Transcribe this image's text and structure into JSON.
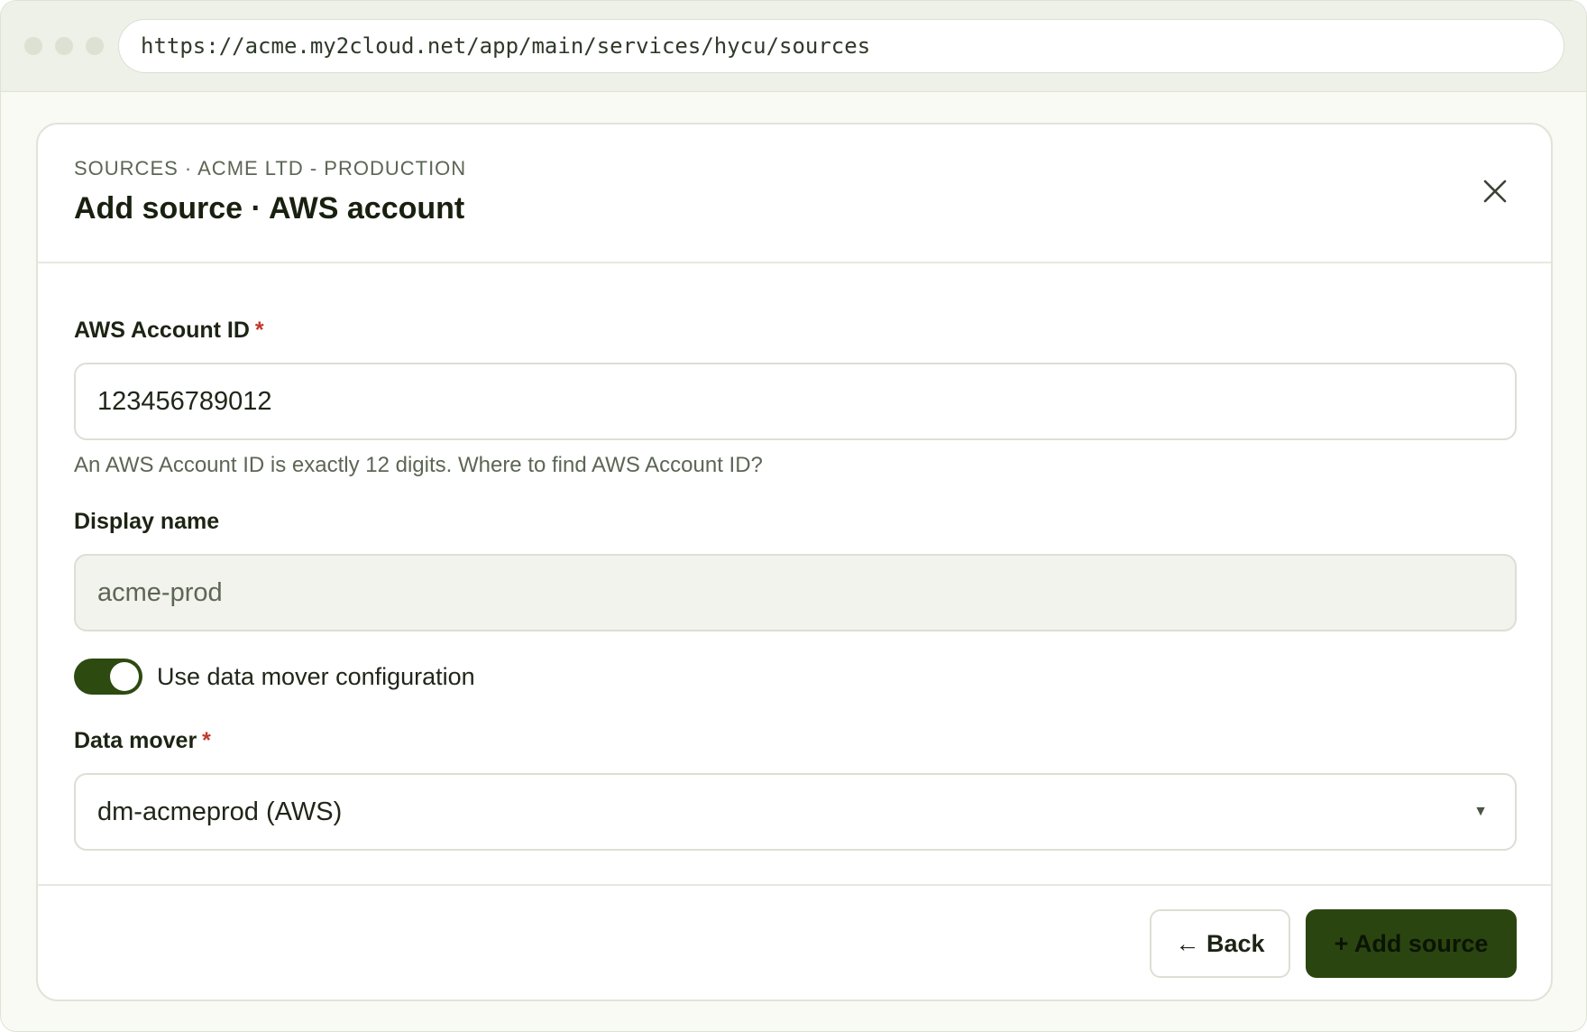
{
  "browser": {
    "url": "https://acme.my2cloud.net/app/main/services/hycu/sources"
  },
  "dialog": {
    "breadcrumb": "SOURCES · ACME LTD - PRODUCTION",
    "title": "Add source · AWS account",
    "close_icon": "close-icon"
  },
  "form": {
    "account_id": {
      "label": "AWS Account ID",
      "required_mark": "*",
      "value": "123456789012",
      "help": "An AWS Account ID is exactly 12 digits. Where to find AWS Account ID?"
    },
    "display_name": {
      "label": "Display name",
      "value": "acme-prod"
    },
    "data_mover_toggle": {
      "label": "Use data mover configuration",
      "on": true
    },
    "data_mover": {
      "label": "Data mover",
      "required_mark": "*",
      "selected": "dm-acmeprod (AWS)"
    }
  },
  "footer": {
    "back_label": "← Back",
    "add_label": "+ Add source"
  },
  "colors": {
    "accent": "#2b4510",
    "required": "#c0392b"
  }
}
